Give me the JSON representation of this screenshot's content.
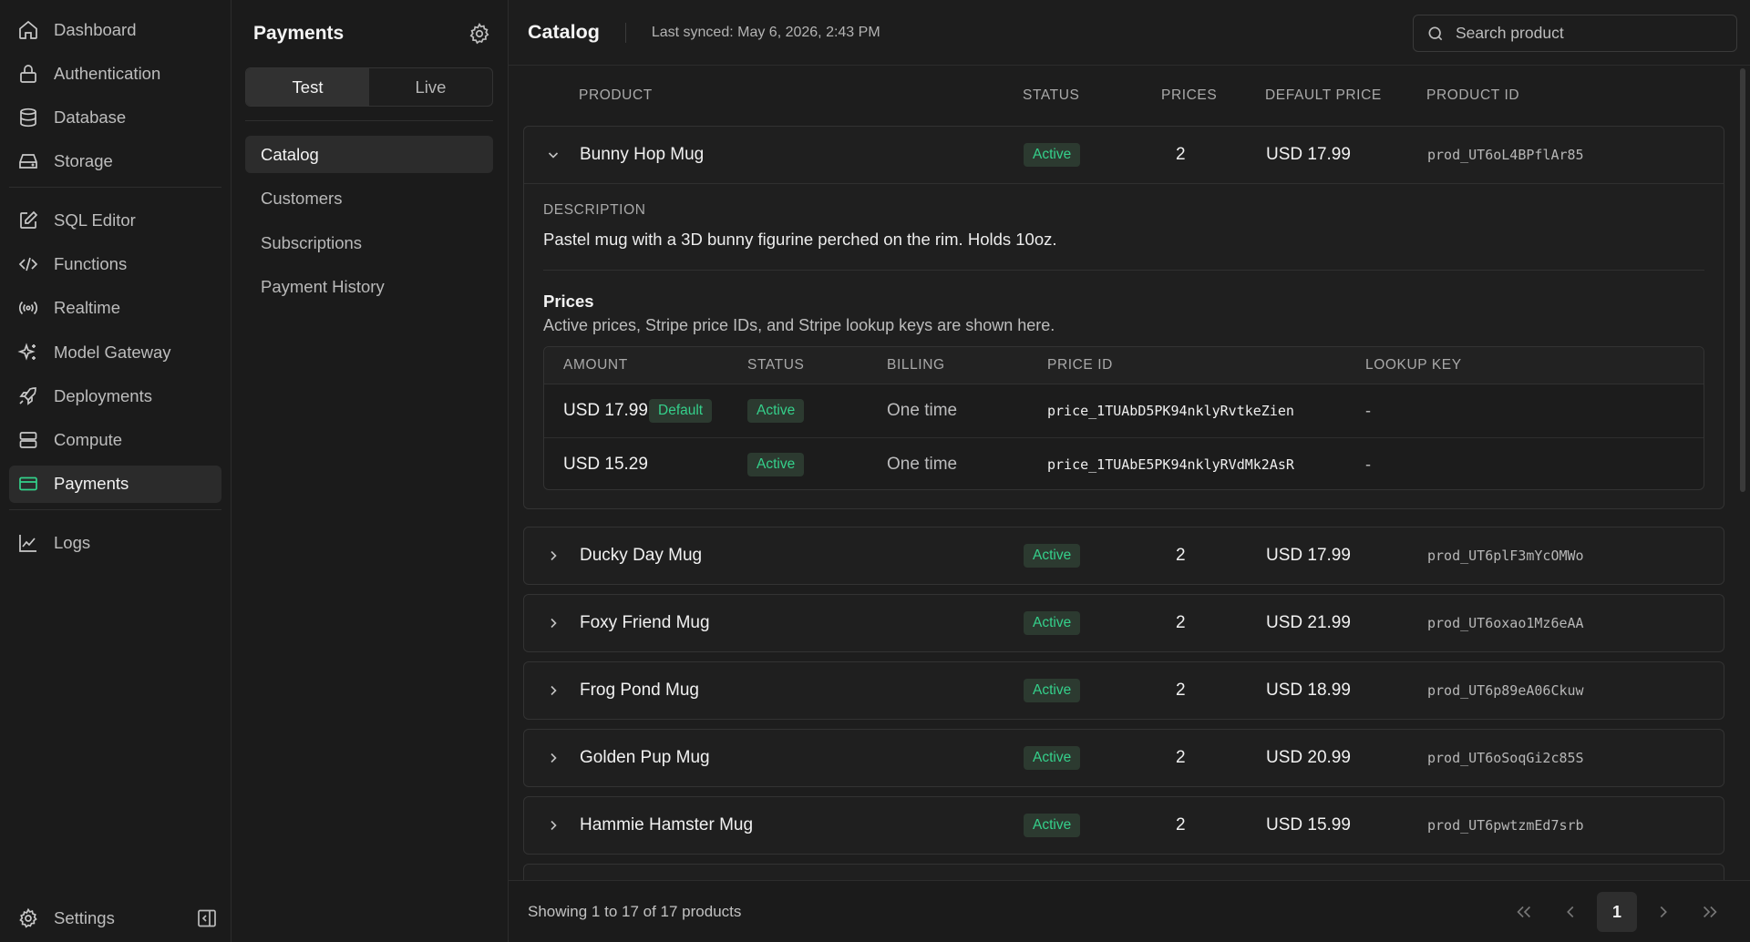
{
  "nav": {
    "items": [
      {
        "label": "Dashboard",
        "icon": "home-icon"
      },
      {
        "label": "Authentication",
        "icon": "lock-icon"
      },
      {
        "label": "Database",
        "icon": "database-icon"
      },
      {
        "label": "Storage",
        "icon": "storage-icon"
      },
      {
        "label": "SQL Editor",
        "icon": "edit-icon"
      },
      {
        "label": "Functions",
        "icon": "code-icon"
      },
      {
        "label": "Realtime",
        "icon": "broadcast-icon"
      },
      {
        "label": "Model Gateway",
        "icon": "sparkles-icon"
      },
      {
        "label": "Deployments",
        "icon": "rocket-icon"
      },
      {
        "label": "Compute",
        "icon": "server-icon"
      },
      {
        "label": "Payments",
        "icon": "credit-card-icon",
        "active": true
      },
      {
        "label": "Logs",
        "icon": "chart-line-icon"
      }
    ],
    "settings_label": "Settings"
  },
  "subpanel": {
    "title": "Payments",
    "modes": [
      "Test",
      "Live"
    ],
    "active_mode": "Test",
    "items": [
      "Catalog",
      "Customers",
      "Subscriptions",
      "Payment History"
    ],
    "active_item": "Catalog"
  },
  "topbar": {
    "title": "Catalog",
    "sync_text": "Last synced: May 6, 2026, 2:43 PM",
    "search_placeholder": "Search product"
  },
  "table": {
    "headers": {
      "product": "PRODUCT",
      "status": "STATUS",
      "prices": "PRICES",
      "default_price": "DEFAULT PRICE",
      "product_id": "PRODUCT ID"
    },
    "rows": [
      {
        "name": "Bunny Hop Mug",
        "status": "Active",
        "prices": "2",
        "default_price": "USD 17.99",
        "product_id": "prod_UT6oL4BPflAr85",
        "expanded": true
      },
      {
        "name": "Ducky Day Mug",
        "status": "Active",
        "prices": "2",
        "default_price": "USD 17.99",
        "product_id": "prod_UT6plF3mYcOMWo"
      },
      {
        "name": "Foxy Friend Mug",
        "status": "Active",
        "prices": "2",
        "default_price": "USD 21.99",
        "product_id": "prod_UT6oxao1Mz6eAA"
      },
      {
        "name": "Frog Pond Mug",
        "status": "Active",
        "prices": "2",
        "default_price": "USD 18.99",
        "product_id": "prod_UT6p89eA06Ckuw"
      },
      {
        "name": "Golden Pup Mug",
        "status": "Active",
        "prices": "2",
        "default_price": "USD 20.99",
        "product_id": "prod_UT6oSoqGi2c85S"
      },
      {
        "name": "Hammie Hamster Mug",
        "status": "Active",
        "prices": "2",
        "default_price": "USD 15.99",
        "product_id": "prod_UT6pwtzmEd7srb"
      }
    ]
  },
  "detail": {
    "description_label": "DESCRIPTION",
    "description": "Pastel mug with a 3D bunny figurine perched on the rim. Holds 10oz.",
    "prices_title": "Prices",
    "prices_subtitle": "Active prices, Stripe price IDs, and Stripe lookup keys are shown here.",
    "headers": {
      "amount": "AMOUNT",
      "status": "STATUS",
      "billing": "BILLING",
      "price_id": "PRICE ID",
      "lookup_key": "LOOKUP KEY"
    },
    "prices": [
      {
        "amount": "USD 17.99",
        "default_badge": "Default",
        "status": "Active",
        "billing": "One time",
        "price_id": "price_1TUAbD5PK94nklyRvtkeZien",
        "lookup_key": "-"
      },
      {
        "amount": "USD 15.29",
        "status": "Active",
        "billing": "One time",
        "price_id": "price_1TUAbE5PK94nklyRVdMk2AsR",
        "lookup_key": "-"
      }
    ]
  },
  "footer": {
    "showing": "Showing 1 to 17 of 17 products",
    "current_page": "1"
  },
  "colors": {
    "accent": "#33d18a",
    "badge_bg": "#2c3a30",
    "background": "#1b1b1b"
  }
}
